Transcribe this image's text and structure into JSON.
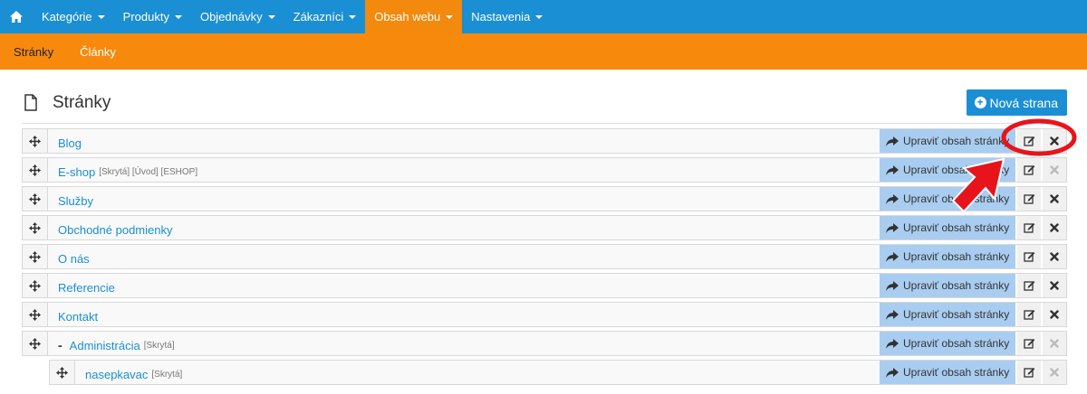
{
  "topnav": {
    "items": [
      {
        "label": "Kategórie"
      },
      {
        "label": "Produkty"
      },
      {
        "label": "Objednávky"
      },
      {
        "label": "Zákazníci"
      },
      {
        "label": "Obsah webu",
        "active": true
      },
      {
        "label": "Nastavenia"
      }
    ]
  },
  "subnav": {
    "items": [
      {
        "label": "Stránky",
        "active": true
      },
      {
        "label": "Články"
      }
    ]
  },
  "header": {
    "title": "Stránky",
    "new_button": "Nová strana"
  },
  "edit_label": "Upraviť obsah stránky",
  "rows": [
    {
      "name": "Blog",
      "tags": "",
      "delete_enabled": true
    },
    {
      "name": "E-shop",
      "tags": "[Skrytá] [Úvod] [ESHOP]",
      "delete_enabled": false
    },
    {
      "name": "Služby",
      "tags": "",
      "delete_enabled": true
    },
    {
      "name": "Obchodné podmienky",
      "tags": "",
      "delete_enabled": true
    },
    {
      "name": "O nás",
      "tags": "",
      "delete_enabled": true
    },
    {
      "name": "Referencie",
      "tags": "",
      "delete_enabled": true
    },
    {
      "name": "Kontakt",
      "tags": "",
      "delete_enabled": true
    },
    {
      "name": "Administrácia",
      "tags": "[Skrytá]",
      "delete_enabled": false,
      "collapse": "-"
    },
    {
      "name": "nasepkavac",
      "tags": "[Skrytá]",
      "delete_enabled": false,
      "child": true
    }
  ],
  "colors": {
    "primary": "#1a8fd4",
    "accent": "#f7890c",
    "edit_bg": "#a9cdf0",
    "annotation": "#e8141c"
  },
  "icons": {
    "home": "home-icon",
    "document": "document-icon",
    "move": "move-icon",
    "share": "share-arrow-icon",
    "edit": "edit-icon",
    "delete": "close-icon"
  }
}
